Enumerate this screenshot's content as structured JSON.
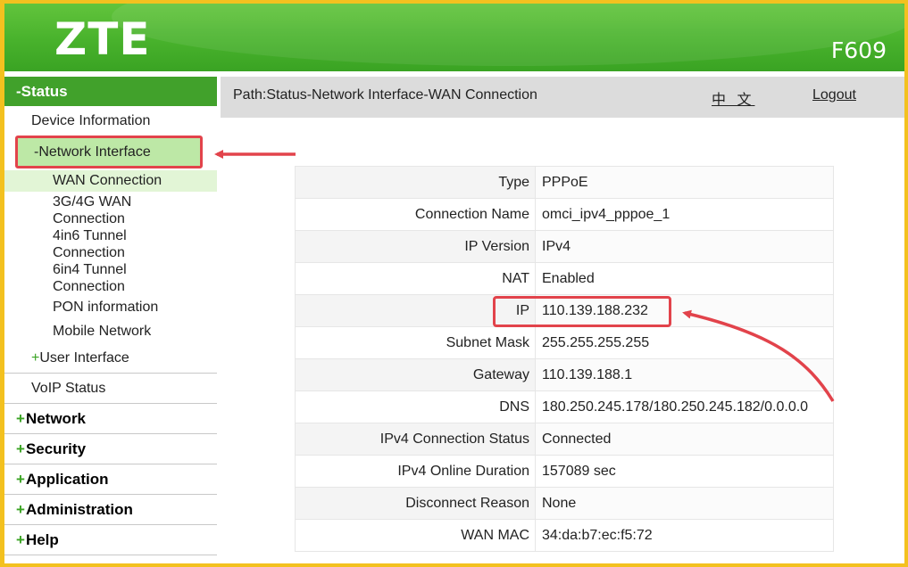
{
  "header": {
    "logo": "ZTE",
    "model": "F609"
  },
  "path_bar": {
    "path": "Path:Status-Network Interface-WAN Connection",
    "language_link": "中 文",
    "logout": "Logout"
  },
  "sidebar": {
    "status": "-Status",
    "device_information": "Device Information",
    "network_interface": "-Network Interface",
    "network_interface_children": [
      "WAN Connection",
      "3G/4G WAN",
      "Connection",
      "4in6 Tunnel",
      "Connection",
      "6in4 Tunnel",
      "Connection",
      "PON information",
      "Mobile Network"
    ],
    "user_interface_plus": "+",
    "user_interface": "User Interface",
    "voip_status": "VoIP Status",
    "categories": [
      {
        "plus": "+",
        "label": "Network"
      },
      {
        "plus": "+",
        "label": "Security"
      },
      {
        "plus": "+",
        "label": "Application"
      },
      {
        "plus": "+",
        "label": "Administration"
      },
      {
        "plus": "+",
        "label": "Help"
      }
    ]
  },
  "wan": {
    "rows": [
      {
        "key": "Type",
        "value": "PPPoE"
      },
      {
        "key": "Connection Name",
        "value": "omci_ipv4_pppoe_1"
      },
      {
        "key": "IP Version",
        "value": "IPv4"
      },
      {
        "key": "NAT",
        "value": "Enabled"
      },
      {
        "key": "IP",
        "value": "110.139.188.232"
      },
      {
        "key": "Subnet Mask",
        "value": "255.255.255.255"
      },
      {
        "key": "Gateway",
        "value": "110.139.188.1"
      },
      {
        "key": "DNS",
        "value": "180.250.245.178/180.250.245.182/0.0.0.0"
      },
      {
        "key": "IPv4 Connection Status",
        "value": "Connected"
      },
      {
        "key": "IPv4 Online Duration",
        "value": "157089 sec"
      },
      {
        "key": "Disconnect Reason",
        "value": "None"
      },
      {
        "key": "WAN MAC",
        "value": "34:da:b7:ec:f5:72"
      }
    ]
  },
  "colors": {
    "brand_green": "#3aa323",
    "highlight_red": "#e2434b",
    "frame_yellow": "#f3c11f"
  }
}
